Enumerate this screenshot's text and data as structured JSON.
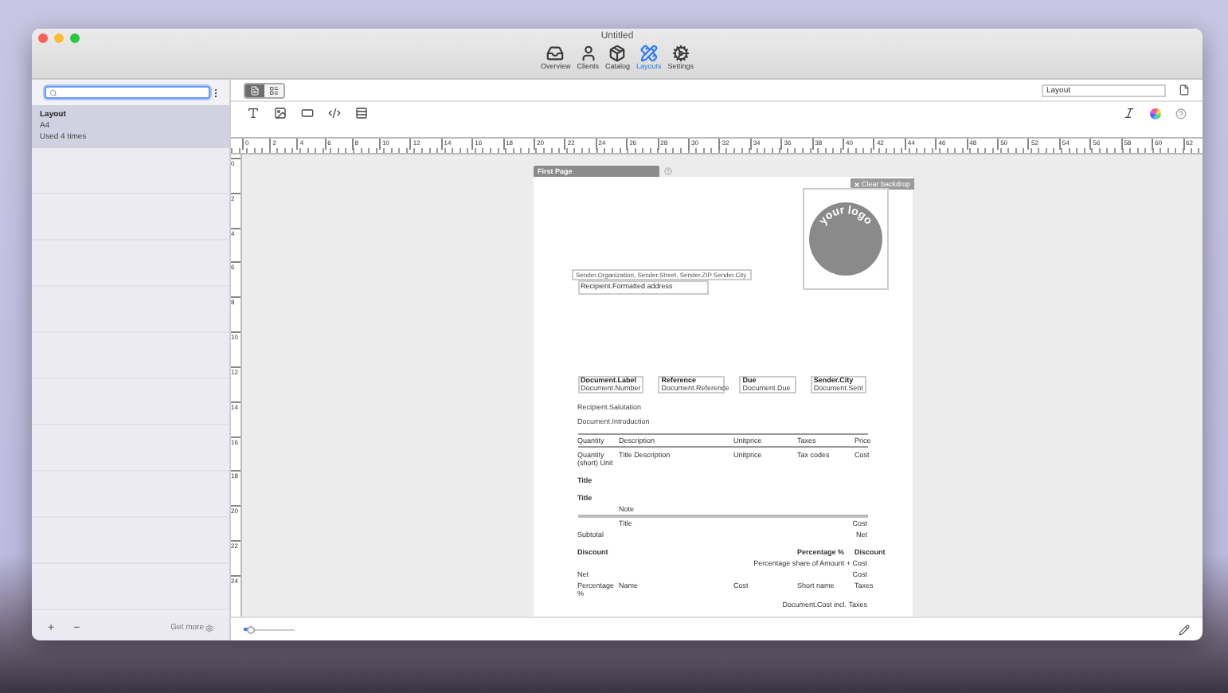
{
  "window": {
    "title": "Untitled"
  },
  "toolbar": [
    {
      "kind": "overview",
      "label": "Overview",
      "selected": false
    },
    {
      "kind": "clients",
      "label": "Clients",
      "selected": false
    },
    {
      "kind": "catalog",
      "label": "Catalog",
      "selected": false
    },
    {
      "kind": "layouts",
      "label": "Layouts",
      "selected": true
    },
    {
      "kind": "settings",
      "label": "Settings",
      "selected": false
    }
  ],
  "sidebar": {
    "items": [
      {
        "title": "Layout",
        "format": "A4",
        "usage": "Used 4 times",
        "selected": true
      }
    ],
    "footer": {
      "add": "+",
      "remove": "−",
      "get_more": "Get more"
    }
  },
  "editor": {
    "view_modes": [
      {
        "kind": "page",
        "selected": true
      },
      {
        "kind": "list",
        "selected": false
      }
    ],
    "layout_name": "Layout"
  },
  "ruler": {
    "horizontal": [
      "0",
      "2",
      "4",
      "6",
      "8",
      "10",
      "12",
      "14",
      "16",
      "18",
      "20",
      "22",
      "24",
      "26",
      "28",
      "30",
      "32",
      "34",
      "36",
      "38",
      "40",
      "42",
      "44",
      "46",
      "48",
      "50",
      "52",
      "54",
      "56",
      "58",
      "60",
      "62"
    ],
    "vertical": [
      "0",
      "2",
      "4",
      "6",
      "8",
      "10",
      "12",
      "14",
      "16",
      "18",
      "20",
      "22",
      "24"
    ]
  },
  "page": {
    "tab": "First Page",
    "clear_backdrop": "Clear backdrop",
    "logo_text": "your logo",
    "sender_line": "Sender.Organization, Sender.Street, Sender.ZIP Sender.City",
    "recipient": "Recipient.Formatted address",
    "info_boxes": [
      {
        "label": "Document.Label",
        "value": "Document.Number"
      },
      {
        "label": "Reference",
        "value": "Document.Reference"
      },
      {
        "label": "Due",
        "value": "Document.Due"
      },
      {
        "label": "Sender.City",
        "value": "Document.Sent"
      }
    ],
    "salutation": "Recipient.Salutation",
    "introduction": "Document.Introduction",
    "lines": [
      {
        "kind": "header",
        "col_1": "Quantity",
        "col_2": "Description",
        "col_3": "Unitprice",
        "col_4": "Taxes",
        "col_5": "Price"
      },
      {
        "kind": "plain",
        "col_1": "Quantity (short) Unit",
        "col_2": "Title Description",
        "col_3": "Unitprice",
        "col_4": "Tax codes",
        "col_5": "Cost"
      },
      {
        "kind": "bold",
        "col_1": "Title"
      },
      {
        "kind": "bold",
        "col_1": "Title"
      },
      {
        "kind": "plain",
        "col_2": "Note"
      },
      {
        "kind": "rule",
        "col_2": "Title",
        "col_5": "Cost"
      },
      {
        "kind": "plain",
        "col_1": "Subtotal",
        "col_5": "Net"
      },
      {
        "kind": "bold",
        "col_1": "Discount",
        "col_4": "Percentage %",
        "col_5": "Discount"
      },
      {
        "kind": "plain",
        "col_5": "Percentage share of Amount + Cost"
      },
      {
        "kind": "plain",
        "col_1": "Net",
        "col_5": "Cost"
      },
      {
        "kind": "plain",
        "col_1": "Percentage %",
        "col_2": "Name",
        "col_3": "Cost",
        "col_4": "Short name",
        "col_5": "Taxes"
      },
      {
        "kind": "plain",
        "col_5": "Document.Cost incl. Taxes"
      }
    ]
  },
  "zoom": {
    "level": 0.15
  }
}
